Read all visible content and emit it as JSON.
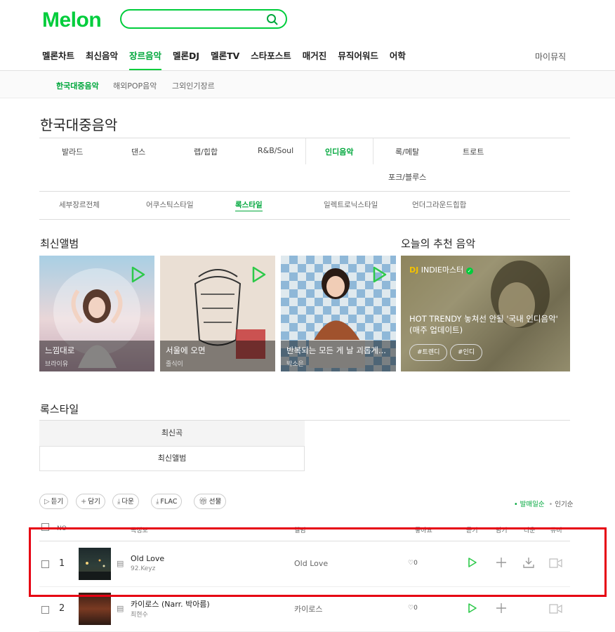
{
  "logo": "Melon",
  "search": {
    "placeholder": ""
  },
  "gnb": [
    "멜론차트",
    "최신음악",
    "장르음악",
    "멜론DJ",
    "멜론TV",
    "스타포스트",
    "매거진",
    "뮤직어워드",
    "어학"
  ],
  "gnb_active": "장르음악",
  "mymusic": "마이뮤직",
  "subnav": [
    "한국대중음악",
    "해외POP음악",
    "그외인기장르"
  ],
  "page_title": "한국대중음악",
  "genres": [
    "발라드",
    "댄스",
    "랩/힙합",
    "R&B/Soul",
    "인디음악",
    "록/메탈",
    "트로트",
    "포크/블루스"
  ],
  "details": [
    "세부장르전체",
    "어쿠스틱스타일",
    "록스타일",
    "일렉트로닉스타일",
    "언더그라운드힙합"
  ],
  "latest_albums": {
    "title": "최신앨범",
    "items": [
      {
        "title": "느낌대로",
        "artist": "브라이유"
      },
      {
        "title": "서울에 오면",
        "artist": "줄식이"
      },
      {
        "title": "반복되는 모든 게 날 괴롭게...",
        "artist": "박소은"
      }
    ]
  },
  "recommend": {
    "title": "오늘의 추천 음악",
    "dj": "DJ",
    "dj_name": "INDIE마스터",
    "text": "HOT TRENDY 놓쳐선 안될 '국내 인디음악' (매주 업데이트)",
    "tags": [
      "#트렌디",
      "#인디"
    ]
  },
  "style_section": {
    "title": "록스타일",
    "tabs": [
      "최신곡",
      "최신앨범"
    ]
  },
  "actions": [
    "듣기",
    "담기",
    "다운",
    "FLAC",
    "선물"
  ],
  "sort": [
    "발매일순",
    "인기순"
  ],
  "table_header": [
    "NO",
    "곡정보",
    "앨범",
    "좋아요",
    "듣기",
    "담기",
    "다운",
    "뮤비"
  ],
  "rows": [
    {
      "rank": "1",
      "song": "Old Love",
      "artist": "92.Keyz",
      "album": "Old Love",
      "likes": "0"
    },
    {
      "rank": "2",
      "song": "카이로스 (Narr. 박아름)",
      "artist": "최현수",
      "album": "카이로스",
      "likes": "0"
    }
  ],
  "colors": {
    "brand": "#00cd3c",
    "highlight": "#e60012"
  }
}
